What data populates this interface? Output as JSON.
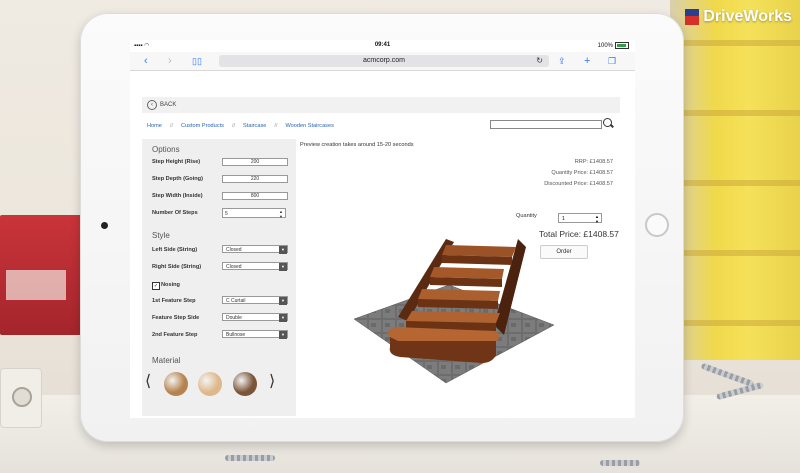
{
  "brand": {
    "name": "DriveWorks"
  },
  "status_bar": {
    "time": "09:41",
    "battery": "100%"
  },
  "browser": {
    "url": "acmcorp.com"
  },
  "page": {
    "back_label": "BACK",
    "breadcrumbs": [
      "Home",
      "Custom Products",
      "Staircase",
      "Wooden Staircases"
    ],
    "search": {
      "value": ""
    },
    "preview_note": "Preview creation takes around 15-20 seconds"
  },
  "options": {
    "heading": "Options",
    "step_height": {
      "label": "Step Height (Rise)",
      "value": "200"
    },
    "step_depth": {
      "label": "Step Depth (Going)",
      "value": "220"
    },
    "step_width": {
      "label": "Step Width (Inside)",
      "value": "800"
    },
    "number_of_steps": {
      "label": "Number Of Steps",
      "value": "5"
    }
  },
  "style": {
    "heading": "Style",
    "left_side": {
      "label": "Left Side (String)",
      "value": "Closed"
    },
    "right_side": {
      "label": "Right Side (String)",
      "value": "Closed"
    },
    "nosing": {
      "label": "Nosing",
      "checked": true
    },
    "first_feature_step": {
      "label": "1st Feature Step",
      "value": "C Curtail"
    },
    "feature_step_side": {
      "label": "Feature Step Side",
      "value": "Double"
    },
    "second_feature_step": {
      "label": "2nd Feature Step",
      "value": "Bullnose"
    }
  },
  "material": {
    "heading": "Material",
    "swatches": [
      "#b5834f",
      "#deb88a",
      "#7a5538"
    ]
  },
  "pricing": {
    "rrp": "RRP: £1408.57",
    "quantity_price": "Quantity Price: £1408.57",
    "discounted_price": "Discounted Price: £1408.57",
    "quantity_label": "Quantity",
    "quantity_value": "1",
    "total": "Total Price: £1408.57",
    "order_label": "Order"
  },
  "colors": {
    "link": "#2a63b4",
    "ios_blue": "#3478f6",
    "wood": "#7a3e1c",
    "brand_red": "#d6302a"
  }
}
